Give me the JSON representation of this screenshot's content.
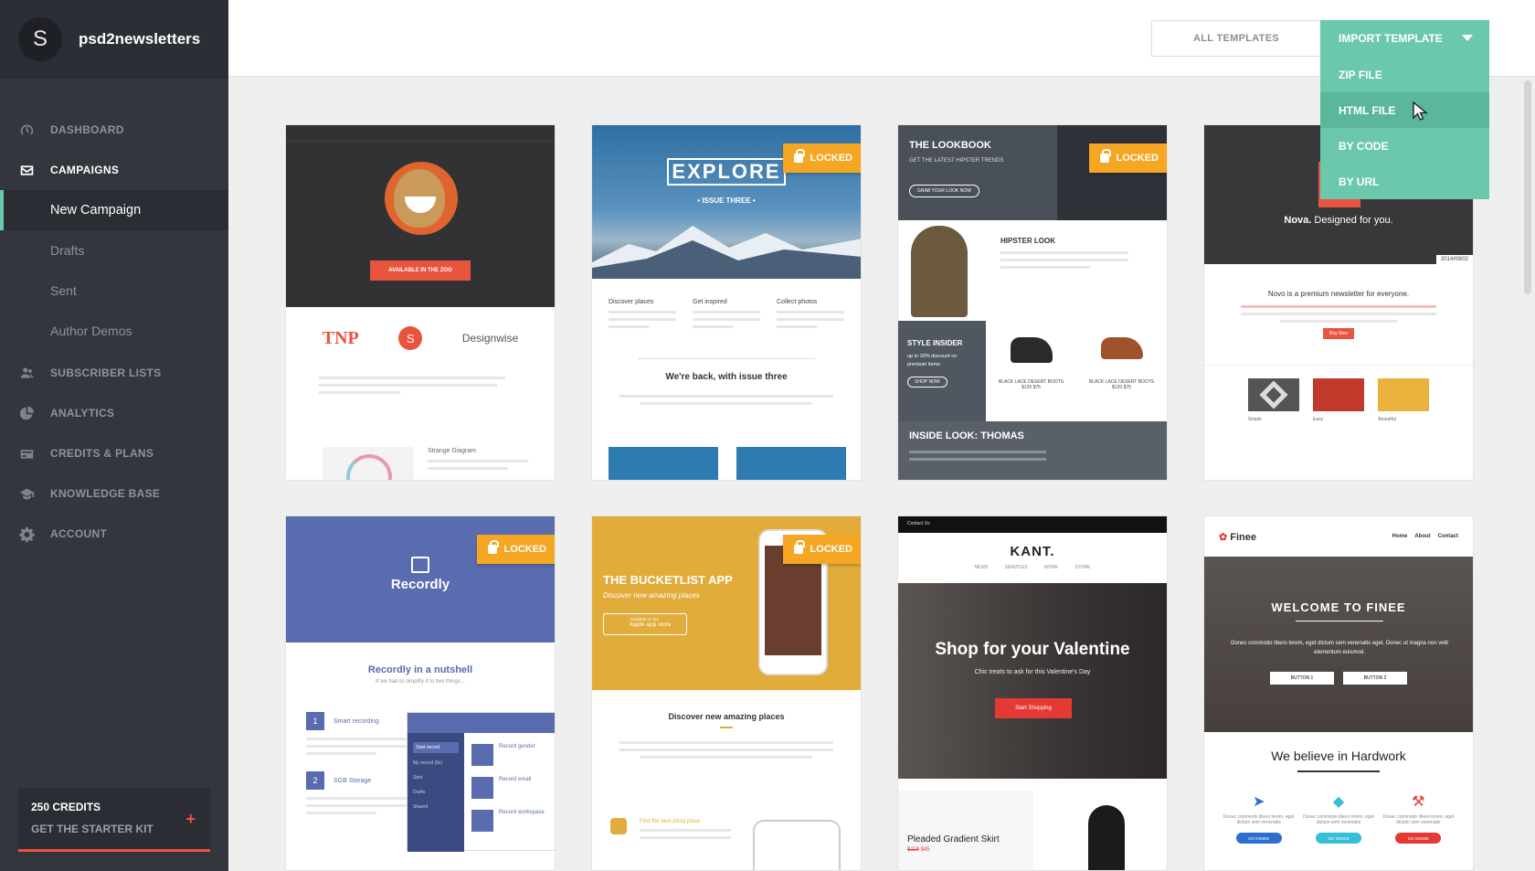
{
  "brand": {
    "initial": "S",
    "name": "psd2newsletters"
  },
  "nav": {
    "dashboard": "DASHBOARD",
    "campaigns": "CAMPAIGNS",
    "campaign_sub": [
      "New Campaign",
      "Drafts",
      "Sent",
      "Author Demos"
    ],
    "subscriber_lists": "SUBSCRIBER LISTS",
    "analytics": "ANALYTICS",
    "credits_plans": "CREDITS & PLANS",
    "knowledge_base": "KNOWLEDGE BASE",
    "account": "ACCOUNT"
  },
  "credits": {
    "title": "250 CREDITS",
    "subtitle": "GET THE STARTER KIT",
    "plus": "+"
  },
  "toolbar": {
    "all_templates": "ALL TEMPLATES",
    "import_label": "IMPORT TEMPLATE",
    "import_options": [
      "ZIP FILE",
      "HTML FILE",
      "BY CODE",
      "BY URL"
    ]
  },
  "locked_label": "LOCKED",
  "cards": {
    "c1": {
      "banner": "AVAILABLE IN THE ZOO",
      "brands": [
        "TNP",
        "S",
        "Designwise"
      ],
      "caption": "Strange Diagram"
    },
    "c2": {
      "title": "EXPLORE",
      "issue": "• ISSUE THREE •",
      "features": [
        "Discover places",
        "Get inspired",
        "Collect photos"
      ],
      "headline": "We're back, with issue three"
    },
    "c3": {
      "title": "THE LOOKBOOK",
      "subtitle": "GET THE LATEST HIPSTER TRENDS",
      "cta": "GRAB YOUR LOOK NOW",
      "hipster": "HIPSTER LOOK",
      "insider": "STYLE INSIDER",
      "insider_sub": "up to 30% discount on premium items",
      "shop": "SHOP NOW",
      "boots1": "BLACK LACE DESERT BOOTS",
      "boots2": "BLACK LACE DESERT BOOTS",
      "price1": "$120 $75",
      "price2": "$120 $75",
      "inside": "INSIDE LOOK: THOMAS"
    },
    "c4": {
      "tagline_bold": "Nova.",
      "tagline": "Designed for you.",
      "date": "2014/09/02",
      "headline": "Novo is a premium newsletter for everyone.",
      "button": "Buy Now",
      "labels": [
        "Simple",
        "Easy",
        "Beautiful"
      ]
    },
    "c5": {
      "title": "Recordly",
      "headline": "Recordly in a nutshell",
      "sub": "If we had to simplify it to two things...",
      "steps": [
        {
          "n": "1",
          "label": "Smart recording"
        },
        {
          "n": "2",
          "label": "SGB Storage"
        }
      ],
      "menu": [
        "Start record",
        "My record (8x)",
        "Sent",
        "Drafts",
        "Shared"
      ],
      "features": [
        "Record gender",
        "Record email",
        "Record workspace"
      ]
    },
    "c6": {
      "title": "THE BUCKETLIST APP",
      "sub": "Discover new amazing places",
      "store_small": "Available on the",
      "store": "Apple app store",
      "headline": "Discover new amazing places",
      "place": "Find the best pizza place"
    },
    "c7": {
      "contact": "Contact Us",
      "brand": "KANT.",
      "menu": [
        "NEWS",
        "SERVICES",
        "WORK",
        "STORE"
      ],
      "headline": "Shop for your Valentine",
      "sub": "Chic treats to ask for this Valentine's Day",
      "cta": "Start Shopping",
      "product": "Pleaded Gradient Skirt",
      "price_old": "$119",
      "price": "$45"
    },
    "c8": {
      "brand": "Finee",
      "menu": [
        "Home",
        "About",
        "Contact"
      ],
      "headline": "WELCOME TO FINEE",
      "sub": "Donec commodo libero lorem, eget dictum sem venenatis eget. Donec ut magna non velit elementum euismod.",
      "btn1": "BUTTON 1",
      "btn2": "BUTTON 2",
      "believe": "We believe in Hardwork",
      "blurb": "Donec commodo libero lorem, eget dictum sem venenatis",
      "go": "GO INSIDE"
    }
  },
  "colors": {
    "accent": "#6cc8ac",
    "sidebar": "#33363d",
    "locked": "#f5a623",
    "danger": "#e9543e"
  }
}
